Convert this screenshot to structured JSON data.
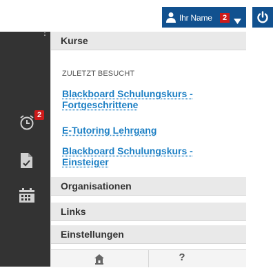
{
  "topbar": {
    "user_name": "Ihr Name",
    "notification_count": "2"
  },
  "rail": {
    "alert_badge": "2"
  },
  "panel": {
    "courses_header": "Kurse",
    "recent_label": "ZULETZT BESUCHT",
    "recent_courses": [
      {
        "title": "Blackboard Schulungskurs - Fortgeschrittene"
      },
      {
        "title": "E-Tutoring Lehrgang"
      },
      {
        "title": "Blackboard Schulungskurs - Einsteiger"
      }
    ],
    "sections": [
      {
        "label": "Organisationen"
      },
      {
        "label": "Links"
      },
      {
        "label": "Einstellungen"
      }
    ],
    "help_label": "?"
  },
  "colors": {
    "brand_blue": "#11518f",
    "link_blue": "#1c7fc4",
    "rail_dark": "#333333",
    "badge_red": "#cc1b1b"
  },
  "icons": {
    "user": "user-icon",
    "caret": "caret-down-icon",
    "power": "power-icon",
    "alarm": "alarm-clock-icon",
    "doc_check": "document-check-icon",
    "calendar": "calendar-icon",
    "home": "home-icon"
  }
}
